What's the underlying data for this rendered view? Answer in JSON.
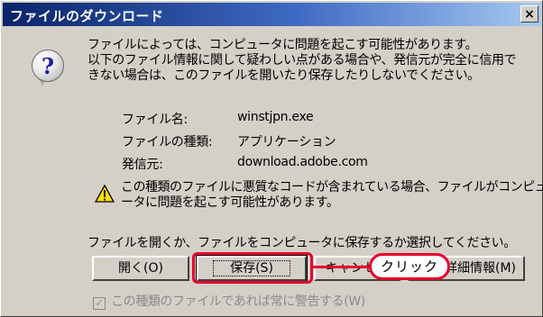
{
  "window": {
    "title": "ファイルのダウンロード",
    "close_label": "×"
  },
  "message": {
    "lines": [
      "ファイルによっては、コンピュータに問題を起こす可能性があります。",
      "以下のファイル情報に関して疑わしい点がある場合や、発信元が完全に信用で",
      "きない場合は、このファイルを開いたり保存したりしないでください。"
    ]
  },
  "file_info": {
    "name_label": "ファイル名:",
    "name_value": "winstjpn.exe",
    "type_label": "ファイルの種類:",
    "type_value": "アプリケーション",
    "source_label": "発信元:",
    "source_value": "download.adobe.com"
  },
  "warning": {
    "lines": [
      "この種類のファイルに悪質なコードが含まれている場合、ファイルがコンピュ",
      "ータに問題を起こす可能性があります。"
    ]
  },
  "prompt": "ファイルを開くか、ファイルをコンピュータに保存するか選択してください。",
  "buttons": {
    "open": "開く(O)",
    "save": "保存(S)",
    "cancel": "キャンセル",
    "details": "詳細情報(M)"
  },
  "callout": "クリック",
  "checkbox": {
    "label": "この種類のファイルであれば常に警告する(W)",
    "checked": true
  },
  "colors": {
    "title_start": "#0a246a",
    "title_end": "#a6caf0",
    "highlight": "#e6002d",
    "face": "#d4d0c8"
  }
}
